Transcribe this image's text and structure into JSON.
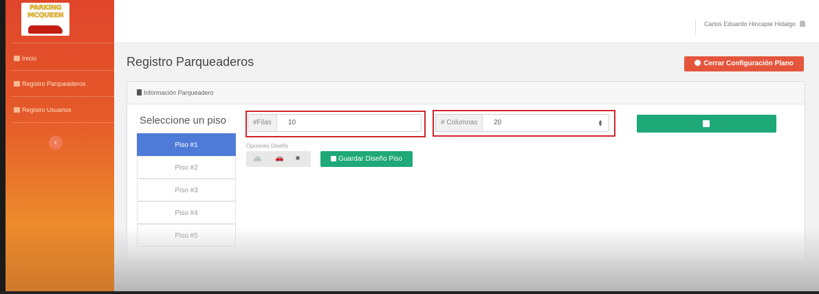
{
  "app": {
    "logo_line1": "PARKING",
    "logo_line2": "MCQUEEN"
  },
  "sidebar": {
    "items": [
      {
        "label": "Inicio",
        "icon": "home-icon"
      },
      {
        "label": "Registro Parqueaderos",
        "icon": "building-icon"
      },
      {
        "label": "Registro Usuarios",
        "icon": "user-icon"
      }
    ],
    "collapse_glyph": "‹"
  },
  "header": {
    "user_name": "Carlos Eduardo Hincapie Hidalgo"
  },
  "main": {
    "title": "Registro Parqueaderos",
    "close_button": "Cerrar Configuración Plano",
    "panel_title": "Información Parqueadero",
    "floors_title": "Seleccione un piso",
    "floors": [
      "Piso #1",
      "Piso #2",
      "Piso #3",
      "Piso #4",
      "Piso #5"
    ],
    "active_floor_index": 0,
    "rows_label": "#Filas",
    "rows_value": "10",
    "cols_label": "# Columnas",
    "cols_value": "20",
    "options_label": "Opciones Diseño",
    "options": [
      {
        "glyph": "🚲",
        "icon": "bicycle-icon"
      },
      {
        "glyph": "🚗",
        "icon": "car-icon"
      },
      {
        "glyph": "■",
        "icon": "square-icon"
      }
    ],
    "save_design_button": "Guardar Diseño Piso"
  },
  "colors": {
    "sidebar_top": "#e0452b",
    "sidebar_bottom": "#ec8a2c",
    "primary_blue": "#4e7bd8",
    "success_green": "#1fa878",
    "danger_red": "#e4553c",
    "highlight_red": "#d0232a"
  }
}
